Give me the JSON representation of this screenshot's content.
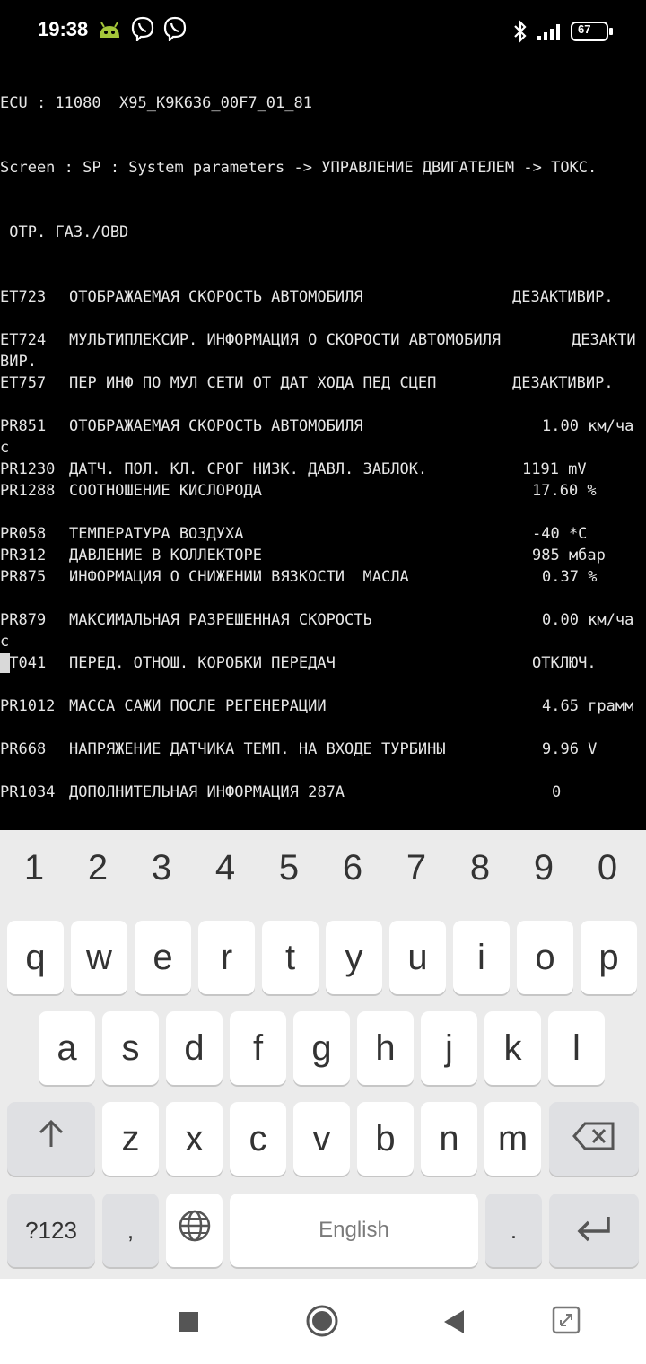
{
  "status_bar": {
    "time": "19:38",
    "icons": [
      "android-icon",
      "viber-icon",
      "viber-icon",
      "bluetooth-icon",
      "signal-icon",
      "battery-icon"
    ],
    "battery": "67"
  },
  "terminal": {
    "header": [
      "ECU : 11080  X95_K9K636_00F7_01_81",
      "Screen : SP : System parameters -> УПРАВЛЕНИЕ ДВИГАТЕЛЕМ -> ТОКС.",
      " ОТР. ГАЗ./OBD"
    ],
    "rows": [
      {
        "code": "ET723",
        "desc": "ОТОБРАЖАЕМАЯ СКОРОСТЬ АВТОМОБИЛЯ",
        "value": "ДЕЗАКТИВИР.",
        "wrap": ""
      },
      {
        "code": "",
        "desc": "",
        "value": "",
        "wrap": ""
      },
      {
        "code": "ET724",
        "desc": "МУЛЬТИПЛЕКСИР. ИНФОРМАЦИЯ О СКОРОСТИ АВТОМОБИЛЯ",
        "value": "ДЕЗАКТИ",
        "wrap": "ВИР."
      },
      {
        "code": "ET757",
        "desc": "ПЕР ИНФ ПО МУЛ СЕТИ ОТ ДАТ ХОДА ПЕД СЦЕП",
        "value": "ДЕЗАКТИВИР.",
        "wrap": ""
      },
      {
        "code": "",
        "desc": "",
        "value": "",
        "wrap": ""
      },
      {
        "code": "PR851",
        "desc": "ОТОБРАЖАЕМАЯ СКОРОСТЬ АВТОМОБИЛЯ",
        "value": "1.00 км/ча",
        "wrap": "с"
      },
      {
        "code": "PR1230",
        "desc": "ДАТЧ. ПОЛ. КЛ. СРОГ НИЗК. ДАВЛ. ЗАБЛОК.",
        "value": "1191 mV",
        "wrap": ""
      },
      {
        "code": "PR1288",
        "desc": "СООТНОШЕНИЕ КИСЛОРОДА",
        "value": "17.60 %",
        "wrap": ""
      },
      {
        "code": "",
        "desc": "",
        "value": "",
        "wrap": ""
      },
      {
        "code": "PR058",
        "desc": "ТЕМПЕРАТУРА ВОЗДУХА",
        "value": "-40 *C",
        "wrap": ""
      },
      {
        "code": "PR312",
        "desc": "ДАВЛЕНИЕ В КОЛЛЕКТОРЕ",
        "value": "985 мбар",
        "wrap": ""
      },
      {
        "code": "PR875",
        "desc": "ИНФОРМАЦИЯ О СНИЖЕНИИ ВЯЗКОСТИ  МАСЛА",
        "value": "0.37 %",
        "wrap": ""
      },
      {
        "code": "",
        "desc": "",
        "value": "",
        "wrap": ""
      },
      {
        "code": "PR879",
        "desc": "МАКСИМАЛЬНАЯ РАЗРЕШЕННАЯ СКОРОСТЬ",
        "value": "0.00 км/ча",
        "wrap": "с"
      },
      {
        "code": "ET041",
        "desc": "ПЕРЕД. ОТНОШ. КОРОБКИ ПЕРЕДАЧ",
        "value": "ОТКЛЮЧ.",
        "wrap": ""
      },
      {
        "code": "",
        "desc": "",
        "value": "",
        "wrap": ""
      },
      {
        "code": "PR1012",
        "desc": "МАССА САЖИ ПОСЛЕ РЕГЕНЕРАЦИИ",
        "value": "4.65 грамм",
        "wrap": ""
      },
      {
        "code": "",
        "desc": "",
        "value": "",
        "wrap": ""
      },
      {
        "code": "PR668",
        "desc": "НАПРЯЖЕНИЕ ДАТЧИКА ТЕМП. НА ВХОДЕ ТУРБИНЫ",
        "value": "9.96 V",
        "wrap": ""
      },
      {
        "code": "",
        "desc": "",
        "value": "",
        "wrap": ""
      },
      {
        "code": "PR1034",
        "desc": "ДОПОЛНИТЕЛЬНАЯ ИНФОРМАЦИЯ 287А",
        "value": "0",
        "wrap": ""
      }
    ]
  },
  "keyboard": {
    "numbers": [
      "1",
      "2",
      "3",
      "4",
      "5",
      "6",
      "7",
      "8",
      "9",
      "0"
    ],
    "row1": [
      "q",
      "w",
      "e",
      "r",
      "t",
      "y",
      "u",
      "i",
      "o",
      "p"
    ],
    "row2": [
      "a",
      "s",
      "d",
      "f",
      "g",
      "h",
      "j",
      "k",
      "l"
    ],
    "row3": [
      "z",
      "x",
      "c",
      "v",
      "b",
      "n",
      "m"
    ],
    "symbols_label": "?123",
    "comma": ",",
    "space_label": "English",
    "period": ".",
    "shift_icon": "arrow-up-icon",
    "backspace_icon": "backspace-icon",
    "enter_icon": "enter-icon",
    "globe_icon": "globe-icon"
  },
  "nav_bar": {
    "icons": [
      "square-icon",
      "home-circle-icon",
      "back-triangle-icon",
      "screenshot-icon"
    ]
  },
  "colors": {
    "terminal_bg": "#000000",
    "terminal_text": "#e6e6e6",
    "keyboard_bg": "#ebebeb",
    "key_bg": "#ffffff",
    "func_key_bg": "#dfe0e3"
  }
}
